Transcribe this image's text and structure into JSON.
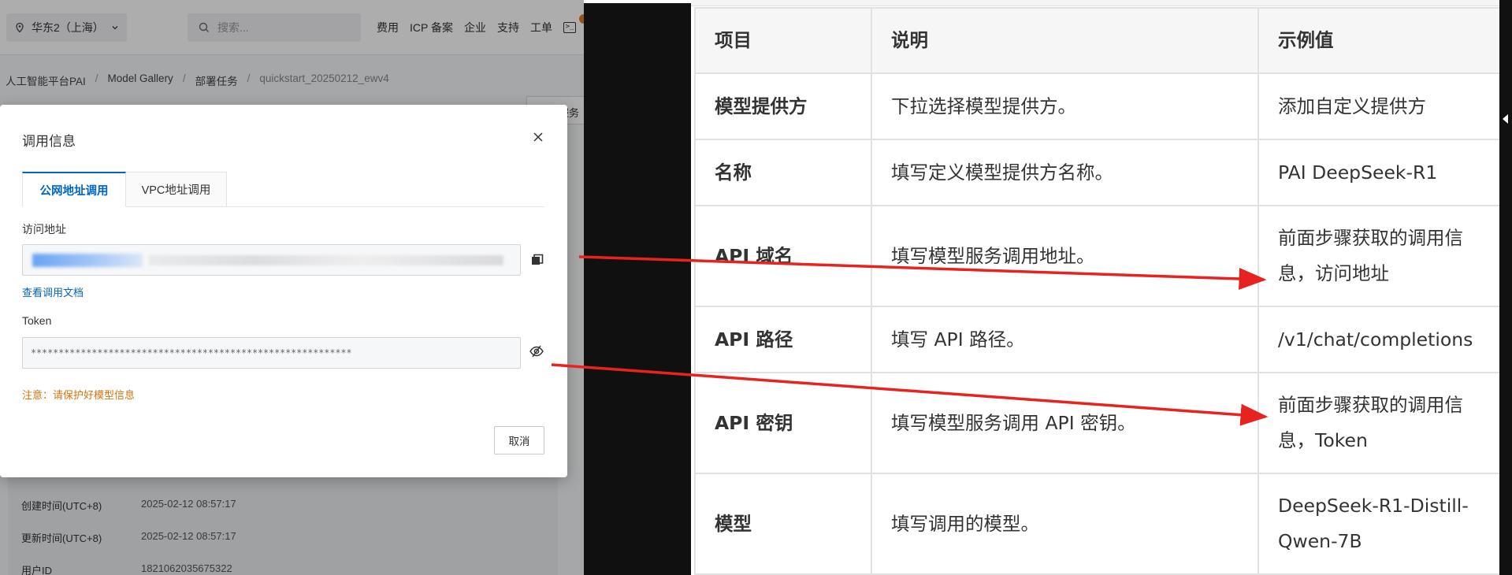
{
  "topbar": {
    "region": "华东2（上海）",
    "search_placeholder": "搜索...",
    "nav": [
      "费用",
      "ICP 备案",
      "企业",
      "支持",
      "工单"
    ],
    "terminal_glyph": ">_"
  },
  "breadcrumb": [
    "人工智能平台PAI",
    "Model Gallery",
    "部署任务",
    "quickstart_20250212_ewv4"
  ],
  "background_button": "服务",
  "details": [
    {
      "key": "创建时间(UTC+8)",
      "value": "2025-02-12 08:57:17"
    },
    {
      "key": "更新时间(UTC+8)",
      "value": "2025-02-12 08:57:17"
    },
    {
      "key": "用户ID",
      "value": "1821062035675322"
    }
  ],
  "dialog": {
    "title": "调用信息",
    "tabs": [
      "公网地址调用",
      "VPC地址调用"
    ],
    "address_label": "访问地址",
    "doc_link": "查看调用文档",
    "token_label": "Token",
    "token_value": "**********************************************************",
    "warning": "注意：请保护好模型信息",
    "cancel": "取消"
  },
  "table": {
    "headers": [
      "项目",
      "说明",
      "示例值"
    ],
    "rows": [
      {
        "item": "模型提供方",
        "desc": "下拉选择模型提供方。",
        "example": "添加自定义提供方"
      },
      {
        "item": "名称",
        "desc": "填写定义模型提供方名称。",
        "example": "PAI DeepSeek-R1"
      },
      {
        "item": "API 域名",
        "desc": "填写模型服务调用地址。",
        "example": "前面步骤获取的调用信息，访问地址"
      },
      {
        "item": "API 路径",
        "desc": "填写 API 路径。",
        "example": "/v1/chat/completions"
      },
      {
        "item": "API 密钥",
        "desc": "填写模型服务调用 API 密钥。",
        "example": "前面步骤获取的调用信息，Token"
      },
      {
        "item": "模型",
        "desc": "填写调用的模型。",
        "example": "DeepSeek-R1-Distill-Qwen-7B"
      }
    ]
  },
  "colors": {
    "accent": "#0064c8",
    "warning": "#d4730c",
    "arrow": "#e8231f"
  }
}
